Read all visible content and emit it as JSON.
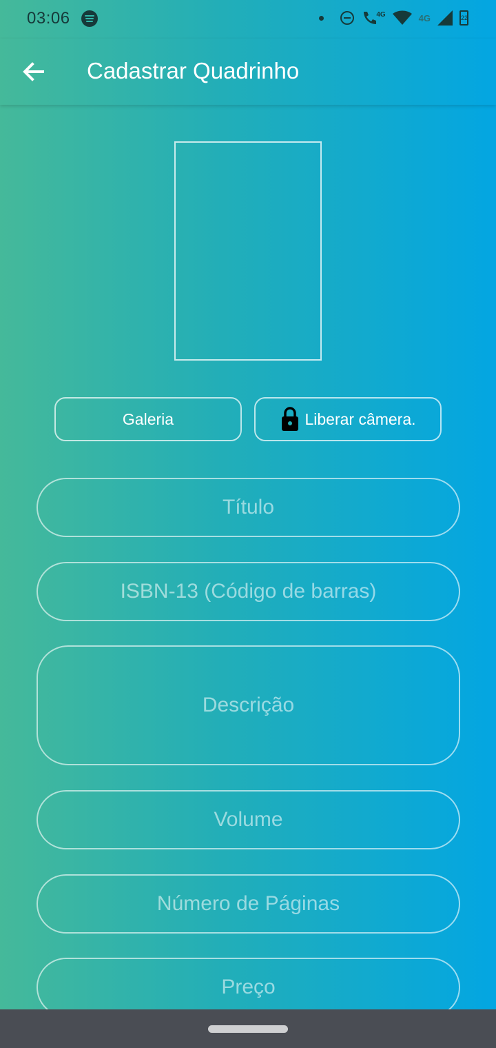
{
  "status_bar": {
    "time": "03:06",
    "icons": [
      "spotify-icon",
      "notification-dot",
      "do-not-disturb-icon",
      "wifi-calling-icon",
      "wifi-icon",
      "signal-icon",
      "battery-icon"
    ],
    "network_label_1": "4G",
    "network_label_2": "4G",
    "battery_level": "22"
  },
  "app_bar": {
    "title": "Cadastrar Quadrinho",
    "back_icon": "arrow-back-icon"
  },
  "cover_image": {
    "icon": "image-placeholder"
  },
  "buttons": {
    "gallery_label": "Galeria",
    "camera_label": "Liberar câmera.",
    "camera_icon": "lock-icon"
  },
  "form": {
    "title_placeholder": "Título",
    "isbn_placeholder": "ISBN-13 (Código de barras)",
    "description_placeholder": "Descrição",
    "volume_placeholder": "Volume",
    "pages_placeholder": "Número de Páginas",
    "price_placeholder": "Preço"
  },
  "colors": {
    "gradient_left": "#45b99a",
    "gradient_right": "#03a6e2",
    "nav_bar": "#4a4d54"
  }
}
